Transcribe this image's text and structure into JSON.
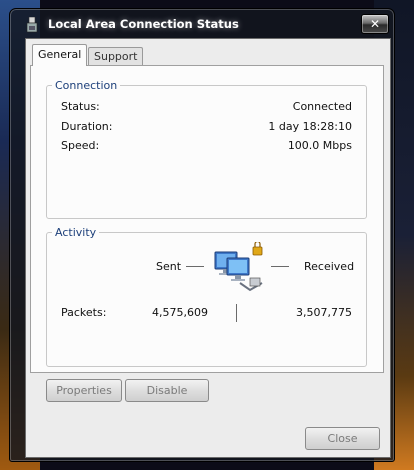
{
  "window": {
    "title": "Local Area Connection Status",
    "close_glyph": "✕"
  },
  "tabs": [
    {
      "label": "General"
    },
    {
      "label": "Support"
    }
  ],
  "connection": {
    "heading": "Connection",
    "rows": [
      {
        "label": "Status:",
        "value": "Connected"
      },
      {
        "label": "Duration:",
        "value": "1 day 18:28:10"
      },
      {
        "label": "Speed:",
        "value": "100.0 Mbps"
      }
    ]
  },
  "activity": {
    "heading": "Activity",
    "sent_label": "Sent",
    "received_label": "Received",
    "packets_label": "Packets:",
    "packets_sent": "4,575,609",
    "packets_received": "3,507,775"
  },
  "buttons": {
    "properties": "Properties",
    "disable": "Disable",
    "close": "Close"
  },
  "icons": {
    "title": "network-adapter-icon",
    "activity": "network-computers-icon"
  }
}
